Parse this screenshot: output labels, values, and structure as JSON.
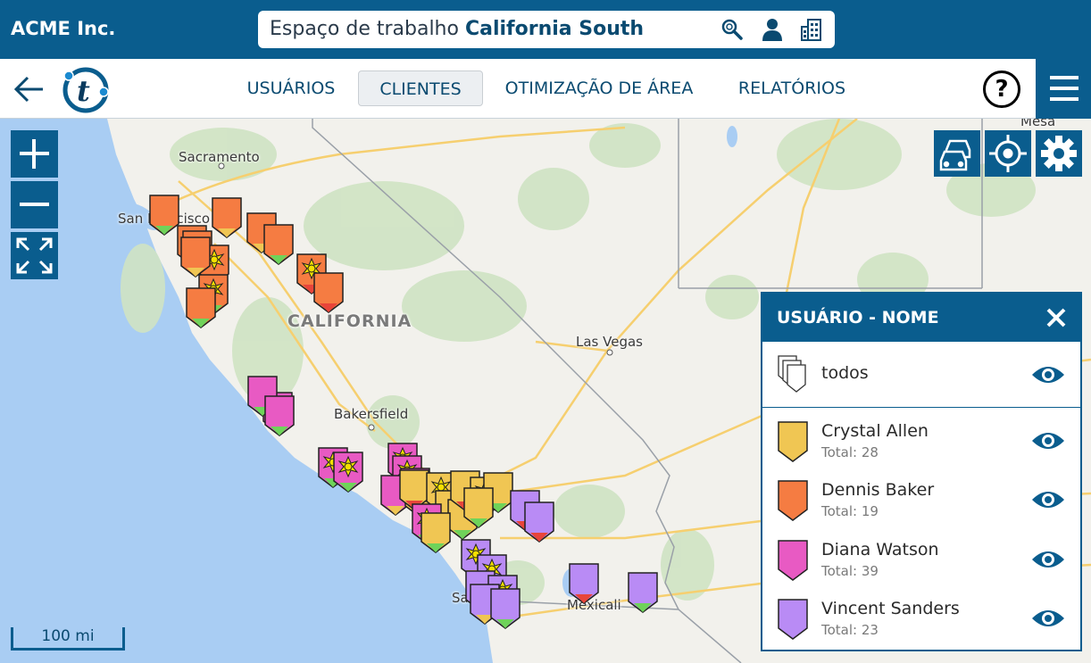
{
  "header": {
    "brand": "ACME Inc.",
    "workspace_prefix": "Espaço de trabalho",
    "workspace_name": "California South",
    "icons": [
      "search-icon",
      "user-icon",
      "building-icon"
    ]
  },
  "nav": {
    "tabs": [
      {
        "label": "USUÁRIOS",
        "active": false
      },
      {
        "label": "CLIENTES",
        "active": true
      },
      {
        "label": "OTIMIZAÇÃO DE ÁREA",
        "active": false
      },
      {
        "label": "RELATÓRIOS",
        "active": false
      }
    ],
    "help_label": "?"
  },
  "map": {
    "labels": {
      "sacramento": "Sacramento",
      "san_francisco": "San Francisco",
      "california": "CALIFORNIA",
      "las_vegas": "Las Vegas",
      "bakersfield": "Bakersfield",
      "san_diego": "San Diego",
      "mexicali": "Mexicali",
      "mesa": "Mesa"
    },
    "scale": "100 mi",
    "controls": [
      "zoom-in",
      "zoom-out",
      "fullscreen",
      "traffic",
      "locate",
      "settings"
    ]
  },
  "legend": {
    "title": "USUÁRIO - NOME",
    "all_label": "todos",
    "users": [
      {
        "name": "Crystal Allen",
        "total": "Total: 28",
        "color": "#f0c653"
      },
      {
        "name": "Dennis Baker",
        "total": "Total: 19",
        "color": "#f57c42"
      },
      {
        "name": "Diana Watson",
        "total": "Total: 39",
        "color": "#e85ac3"
      },
      {
        "name": "Vincent Sanders",
        "total": "Total: 23",
        "color": "#b98bf5"
      }
    ]
  },
  "colors": {
    "primary": "#0a5d8e",
    "yellow": "#f0c653",
    "orange": "#f57c42",
    "pink": "#e85ac3",
    "purple": "#b98bf5",
    "green": "#6fd35a",
    "red": "#e8453a"
  }
}
